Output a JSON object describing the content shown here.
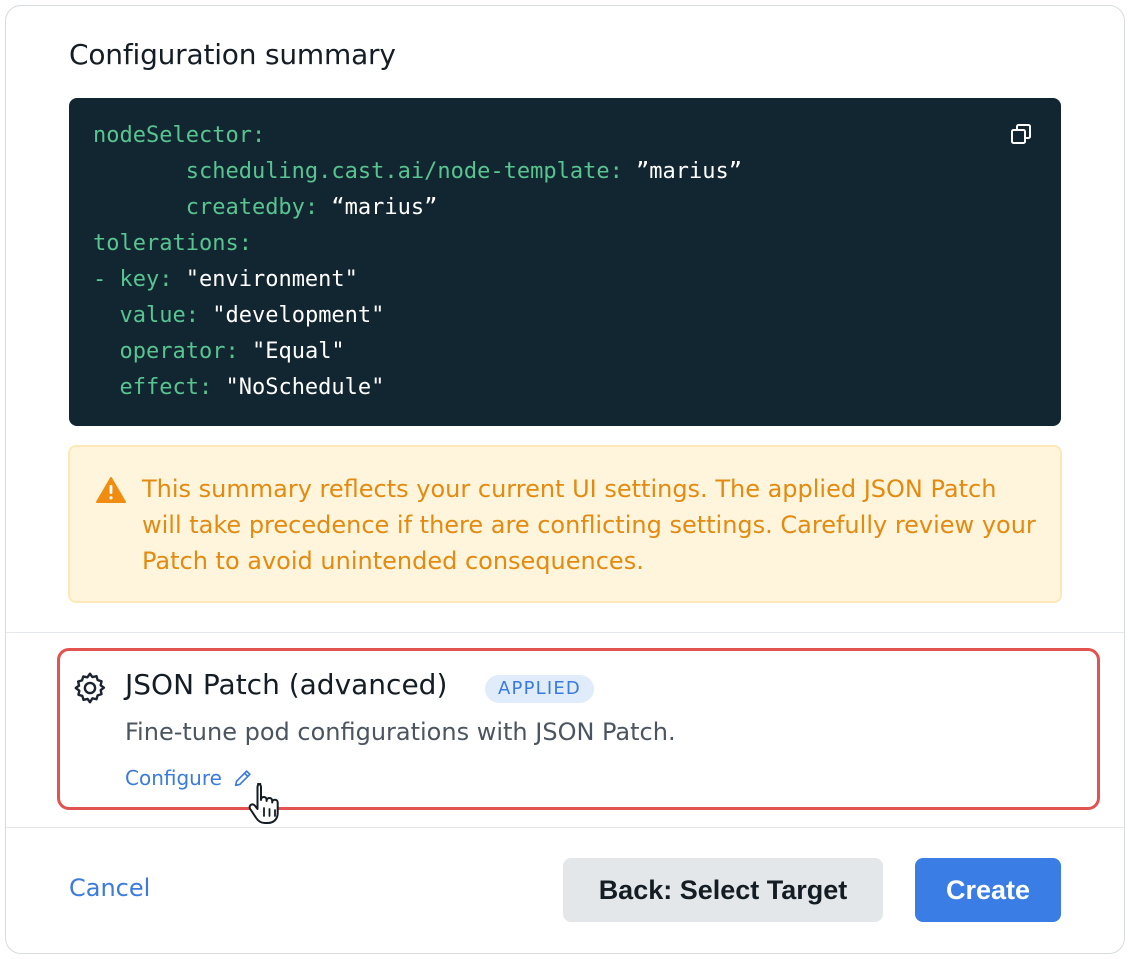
{
  "summary": {
    "title": "Configuration summary",
    "code_lines": [
      {
        "indent": "",
        "key": "nodeSelector:",
        "value": ""
      },
      {
        "indent": "       ",
        "key": "scheduling.cast.ai/node-template:",
        "value": " ”marius”"
      },
      {
        "indent": "       ",
        "key": "createdby:",
        "value": " “marius”"
      },
      {
        "indent": "",
        "key": "tolerations:",
        "value": ""
      },
      {
        "indent": "",
        "key": "- key:",
        "value": " \"environment\""
      },
      {
        "indent": "  ",
        "key": "value:",
        "value": " \"development\""
      },
      {
        "indent": "  ",
        "key": "operator:",
        "value": " \"Equal\""
      },
      {
        "indent": "  ",
        "key": "effect:",
        "value": " \"NoSchedule\""
      }
    ],
    "copy_icon": "copy-icon"
  },
  "warning": {
    "icon": "warning-triangle-icon",
    "text": "This summary reflects your current UI settings. The applied JSON Patch will take precedence if there are conflicting settings. Carefully review your Patch to avoid unintended consequences."
  },
  "json_patch": {
    "icon": "gear-icon",
    "title": "JSON Patch (advanced)",
    "badge": "APPLIED",
    "description": "Fine-tune pod configurations with JSON Patch.",
    "configure_label": "Configure",
    "configure_icon": "pencil-icon"
  },
  "footer": {
    "cancel_label": "Cancel",
    "back_label": "Back: Select Target",
    "create_label": "Create"
  },
  "colors": {
    "accent": "#3a7de5",
    "code_bg": "#122632",
    "code_key": "#58c48f",
    "warning_text": "#e38a10",
    "highlight_border": "#e2524f"
  }
}
